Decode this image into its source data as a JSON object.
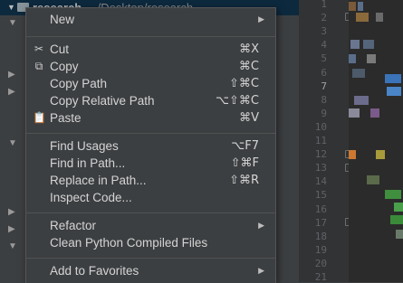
{
  "tree": {
    "root_name": "research",
    "root_path": "~/Desktop/research"
  },
  "gutter": {
    "line_numbers": [
      "1",
      "2",
      "3",
      "4",
      "5",
      "6",
      "7",
      "8",
      "9",
      "10",
      "11",
      "12",
      "13",
      "14",
      "15",
      "16",
      "17",
      "18",
      "19",
      "20",
      "21"
    ],
    "current_line": "7"
  },
  "menu": {
    "new": "New",
    "cut": "Cut",
    "cut_sc": "⌘X",
    "copy": "Copy",
    "copy_sc": "⌘C",
    "copy_path": "Copy Path",
    "copy_path_sc": "⇧⌘C",
    "copy_relative_path": "Copy Relative Path",
    "copy_relative_path_sc": "⌥⇧⌘C",
    "paste": "Paste",
    "paste_sc": "⌘V",
    "find_usages": "Find Usages",
    "find_usages_sc": "⌥F7",
    "find_in_path": "Find in Path...",
    "find_in_path_sc": "⇧⌘F",
    "replace_in_path": "Replace in Path...",
    "replace_in_path_sc": "⇧⌘R",
    "inspect_code": "Inspect Code...",
    "refactor": "Refactor",
    "clean_python": "Clean Python Compiled Files",
    "add_to_favorites": "Add to Favorites"
  },
  "colors": {
    "menu_bg": "#3c3f41",
    "selection_bg": "#0d293e",
    "editor_bg": "#2b2b2b"
  }
}
